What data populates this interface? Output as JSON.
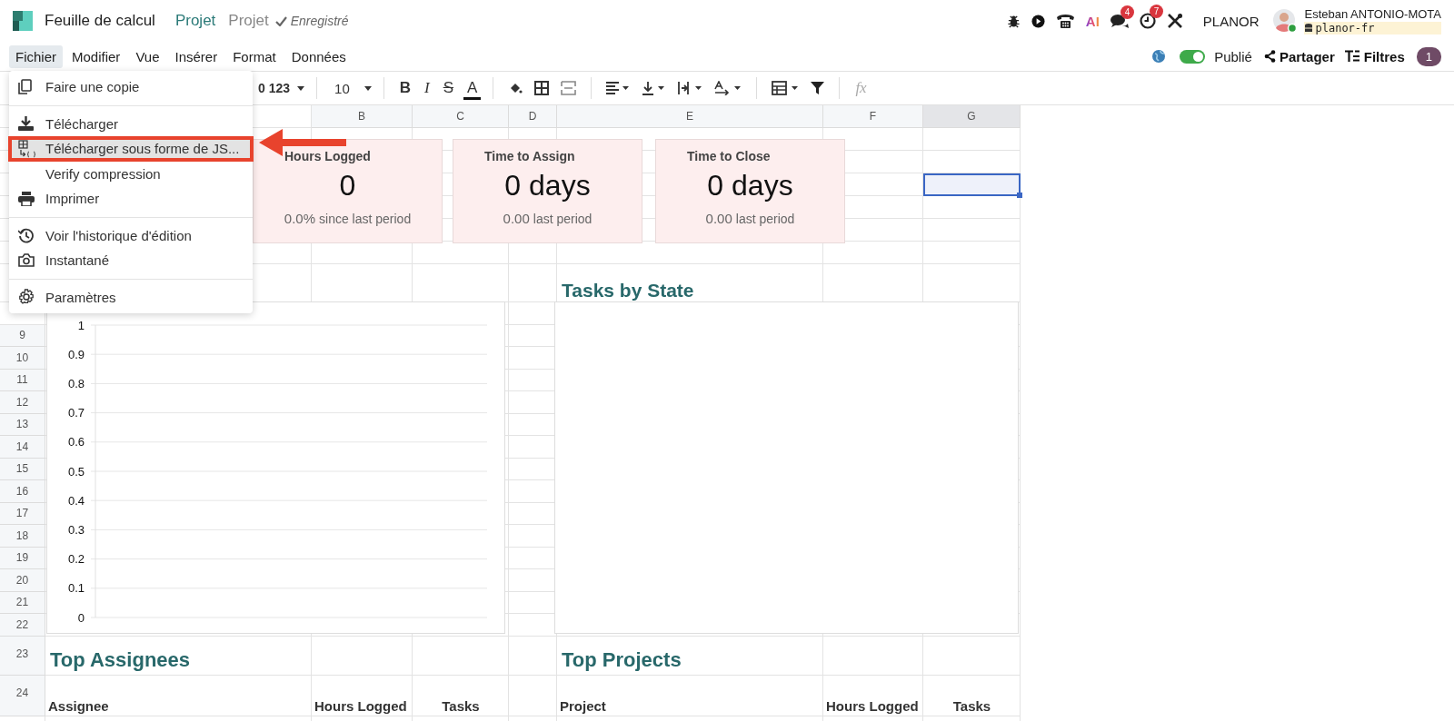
{
  "app": {
    "title": "Feuille de calcul",
    "breadcrumbs": [
      {
        "label": "Projet",
        "kind": "link"
      },
      {
        "label": "Projet",
        "kind": "current"
      }
    ],
    "save_status": "Enregistré"
  },
  "systray": [
    {
      "kind": "bug"
    },
    {
      "kind": "play"
    },
    {
      "kind": "phone"
    },
    {
      "kind": "ai",
      "label": "AI"
    },
    {
      "kind": "chat",
      "badge": "4"
    },
    {
      "kind": "clock",
      "badge": "7"
    },
    {
      "kind": "tools"
    }
  ],
  "company": "PLANOR",
  "user": {
    "name": "Esteban ANTONIO-MOTA",
    "database": "planor-fr"
  },
  "menubar": [
    {
      "label": "Fichier",
      "selected": true
    },
    {
      "label": "Modifier",
      "selected": false
    },
    {
      "label": "Vue",
      "selected": false
    },
    {
      "label": "Insérer",
      "selected": false
    },
    {
      "label": "Format",
      "selected": false
    },
    {
      "label": "Données",
      "selected": false
    }
  ],
  "actions": {
    "published": {
      "on": true,
      "label": "Publié"
    },
    "share": "Partager",
    "filters": {
      "label": "Filtres",
      "count": "1"
    }
  },
  "toolbar": {
    "number_format": "0 123",
    "font_size": "10",
    "styles": [
      {
        "kind": "bold",
        "label": "B"
      },
      {
        "kind": "italic",
        "label": "I"
      },
      {
        "kind": "strike",
        "label": "S"
      },
      {
        "kind": "color",
        "label": "A"
      }
    ],
    "formula_hint": "fx"
  },
  "file_menu": [
    {
      "label": "Faire une copie",
      "kind": "copy",
      "highlighted": false,
      "separator_after": true
    },
    {
      "label": "Télécharger",
      "kind": "download",
      "highlighted": false,
      "separator_after": false
    },
    {
      "label": "Télécharger sous forme de JS...",
      "kind": "json",
      "highlighted": true,
      "separator_after": false
    },
    {
      "label": "Verify compression",
      "kind": "plain",
      "highlighted": false,
      "separator_after": false
    },
    {
      "label": "Imprimer",
      "kind": "print",
      "highlighted": false,
      "separator_after": true
    },
    {
      "label": "Voir l'historique d'édition",
      "kind": "history",
      "highlighted": false,
      "separator_after": false
    },
    {
      "label": "Instantané",
      "kind": "camera",
      "highlighted": false,
      "separator_after": true
    },
    {
      "label": "Paramètres",
      "kind": "gear",
      "highlighted": false,
      "separator_after": false
    }
  ],
  "sheet": {
    "columns": [
      {
        "label": "B",
        "selected": false
      },
      {
        "label": "C",
        "selected": false
      },
      {
        "label": "D",
        "selected": false
      },
      {
        "label": "E",
        "selected": false
      },
      {
        "label": "F",
        "selected": false
      },
      {
        "label": "G",
        "selected": true
      }
    ],
    "row_headers": [
      "9",
      "10",
      "11",
      "12",
      "13",
      "14",
      "15",
      "16",
      "17",
      "18",
      "19",
      "20",
      "21",
      "22",
      "23",
      "24"
    ]
  },
  "scorecards": [
    {
      "title": "Hours Logged",
      "value": "0",
      "delta": "0.0%",
      "caption": "since last period"
    },
    {
      "title": "Time to Assign",
      "value": "0 days",
      "delta": "0.00",
      "caption": "last period"
    },
    {
      "title": "Time to Close",
      "value": "0 days",
      "delta": "0.00",
      "caption": "last period"
    }
  ],
  "bar_chart": {
    "axis_labels": [
      "1",
      "0.9",
      "0.8",
      "0.7",
      "0.6",
      "0.5",
      "0.4",
      "0.3",
      "0.2",
      "0.1",
      "0"
    ]
  },
  "state_chart": {
    "title": "Tasks by State"
  },
  "sections": [
    {
      "title": "Top Assignees",
      "columns": [
        "Assignee",
        "Hours Logged",
        "Tasks"
      ]
    },
    {
      "title": "Top Projects",
      "columns": [
        "Project",
        "Hours Logged",
        "Tasks"
      ]
    }
  ]
}
